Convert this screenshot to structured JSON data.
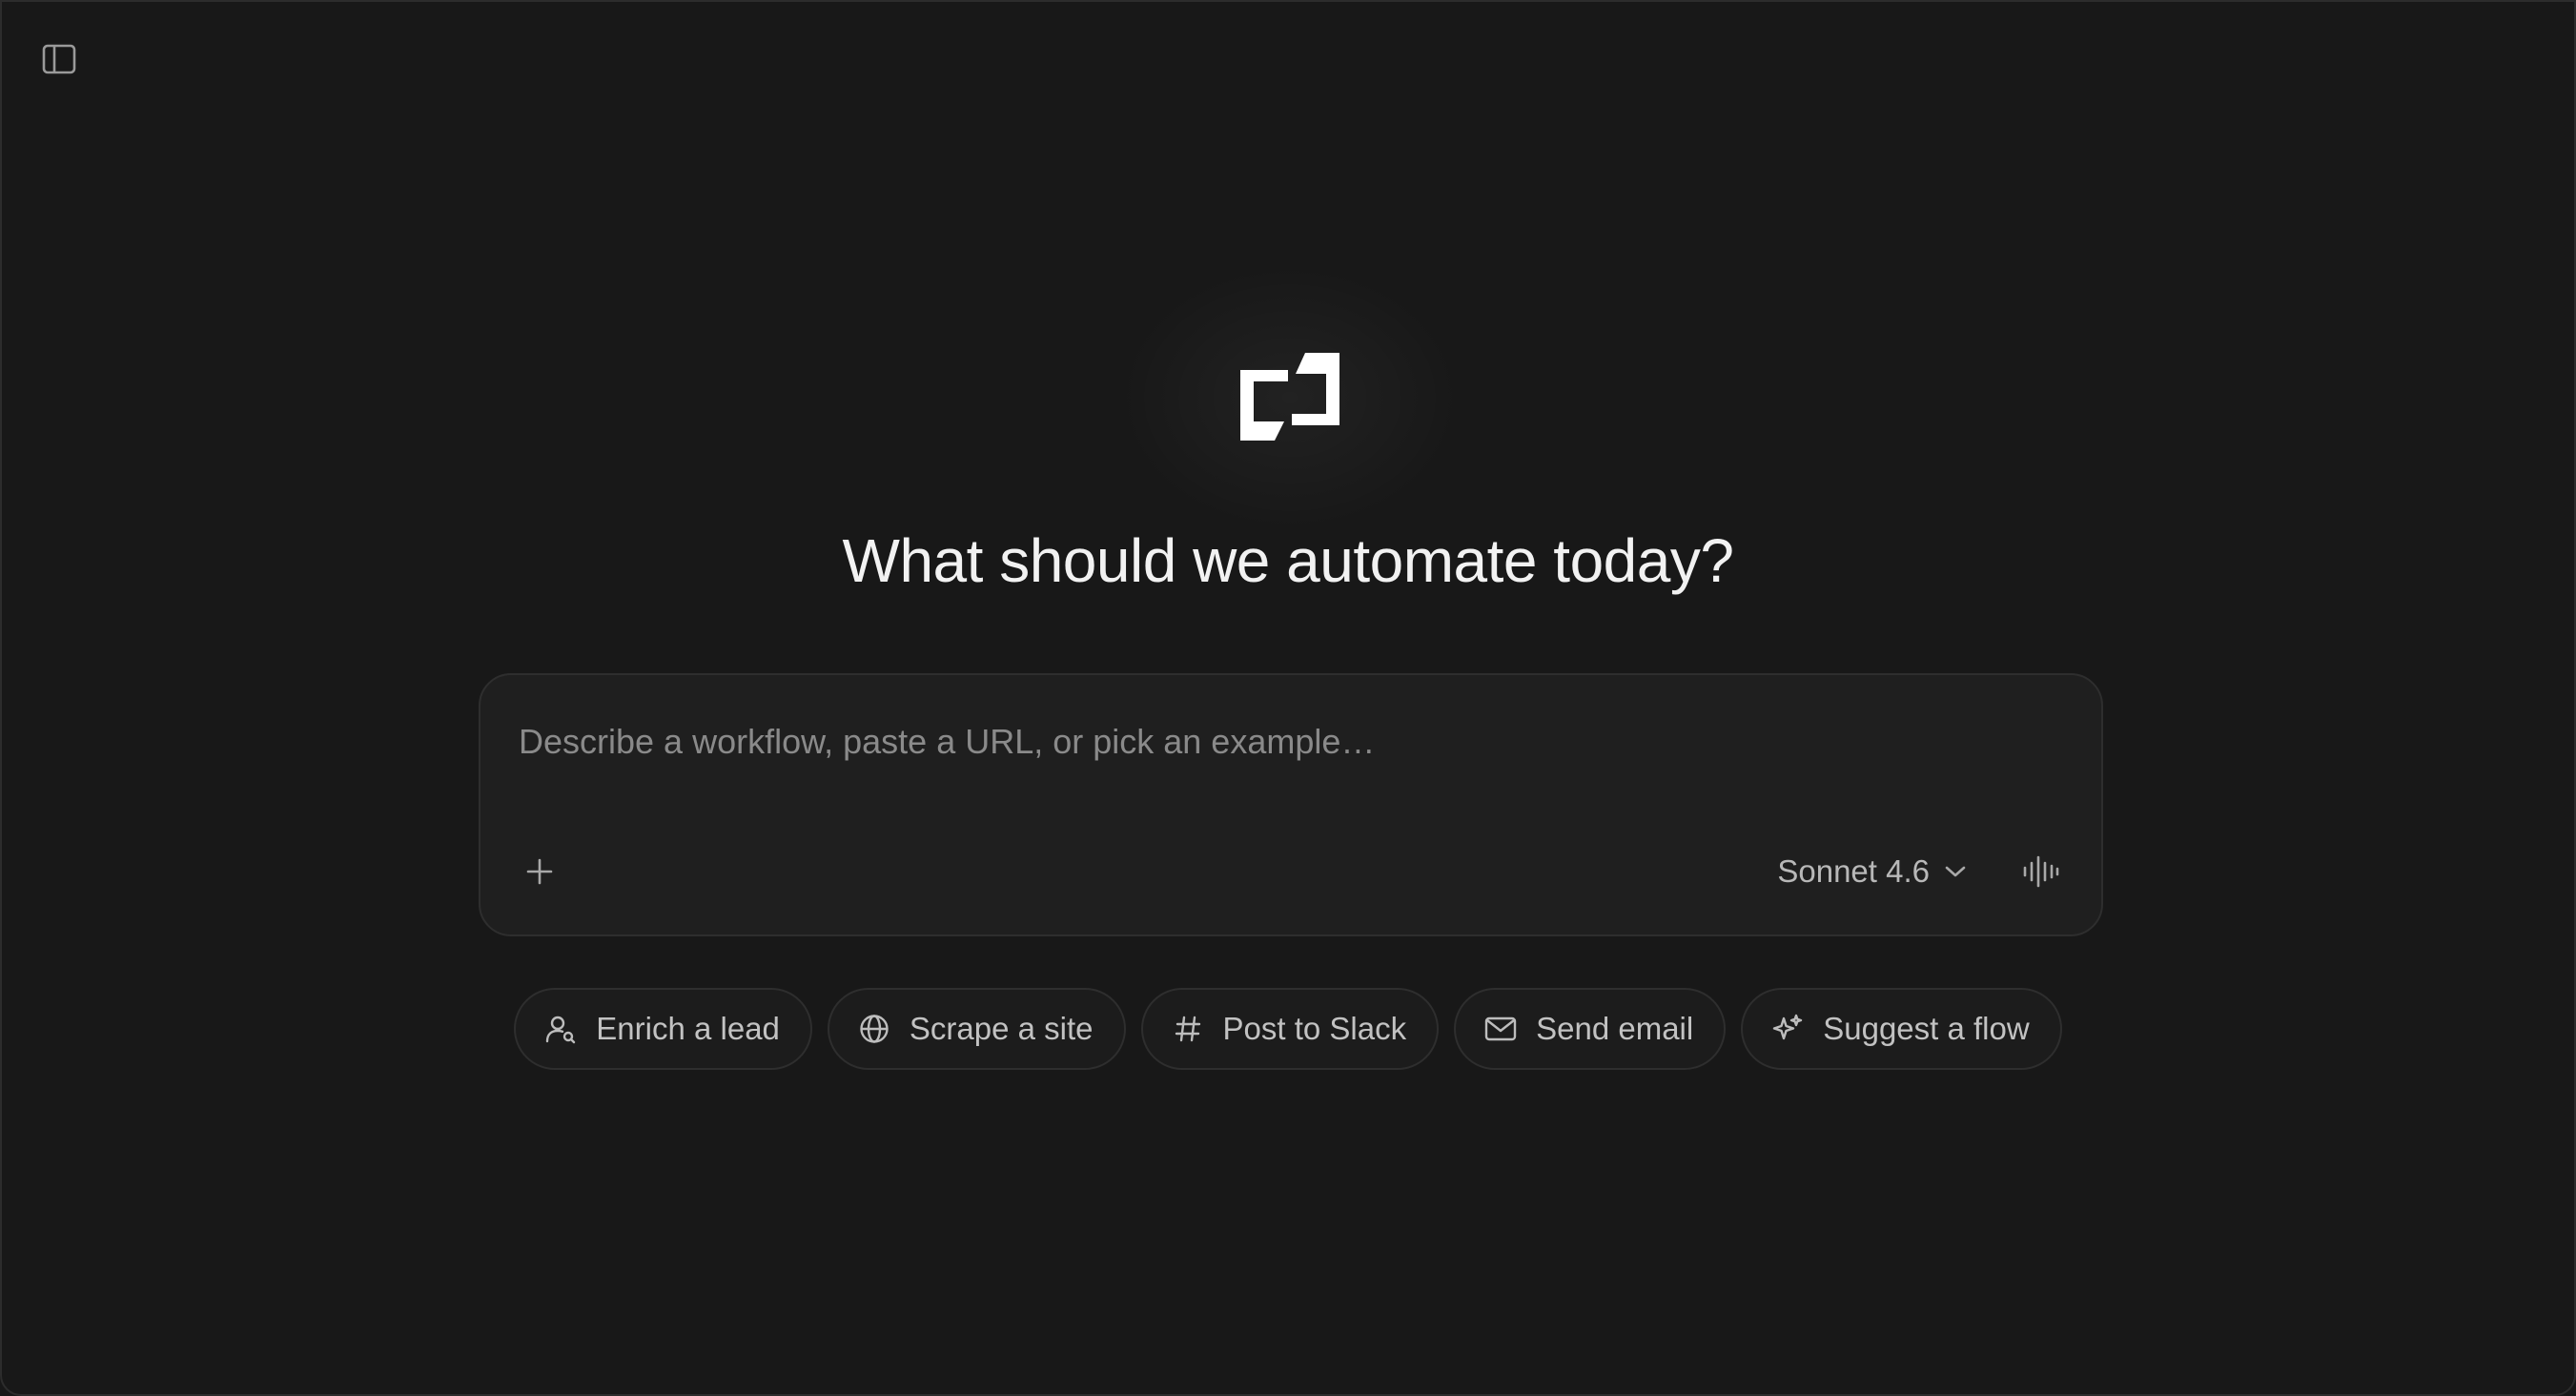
{
  "header": {
    "sidebar_toggle_icon": "sidebar-panel-icon"
  },
  "brand": {
    "logo_icon": "bracket-logo-icon"
  },
  "main": {
    "headline": "What should we automate today?"
  },
  "composer": {
    "placeholder": "Describe a workflow, paste a URL, or pick an example…",
    "value": "",
    "attach_icon": "plus-icon",
    "model": {
      "selected": "Sonnet 4.6",
      "icon": "chevron-down-icon"
    },
    "voice_icon": "waveform-icon"
  },
  "suggestions": [
    {
      "label": "Enrich a lead",
      "icon": "user-search-icon"
    },
    {
      "label": "Scrape a site",
      "icon": "globe-icon"
    },
    {
      "label": "Post to Slack",
      "icon": "hash-icon"
    },
    {
      "label": "Send email",
      "icon": "mail-icon"
    },
    {
      "label": "Suggest a flow",
      "icon": "sparkles-icon"
    }
  ],
  "colors": {
    "background": "#181818",
    "surface": "#1f1f1f",
    "border": "#2e2e2e",
    "text": "#f2f2f2",
    "muted": "#8a8a8a"
  }
}
